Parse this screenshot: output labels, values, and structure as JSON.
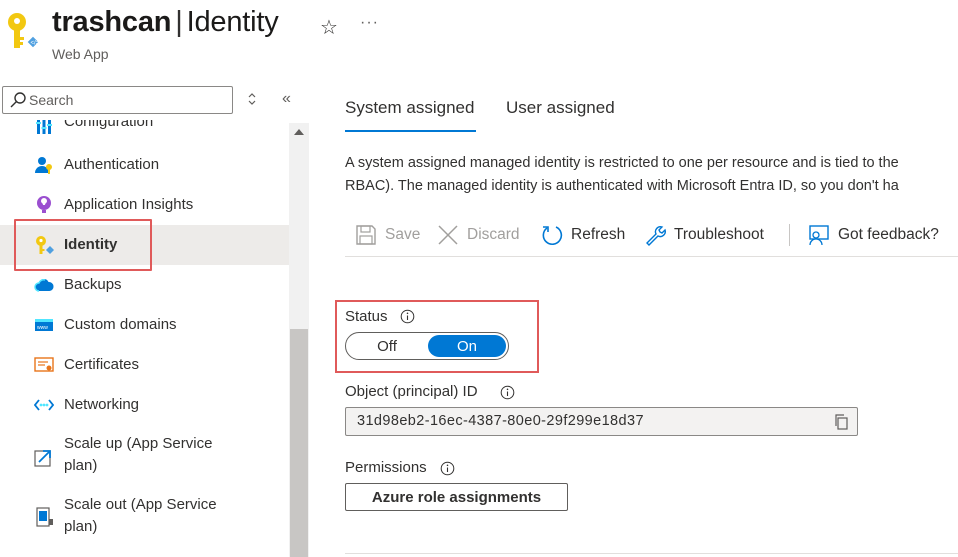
{
  "header": {
    "resource_name": "trashcan",
    "separator": "|",
    "page_name": "Identity",
    "subtitle": "Web App",
    "favorite_icon": "star-icon",
    "more_icon": "ellipsis-icon"
  },
  "sidebar": {
    "search_placeholder": "Search",
    "items": [
      {
        "label": "Configuration",
        "icon": "configuration-icon"
      },
      {
        "label": "Authentication",
        "icon": "authentication-icon"
      },
      {
        "label": "Application Insights",
        "icon": "application-insights-icon"
      },
      {
        "label": "Identity",
        "icon": "identity-key-icon",
        "active": true
      },
      {
        "label": "Backups",
        "icon": "backups-cloud-icon"
      },
      {
        "label": "Custom domains",
        "icon": "custom-domains-icon"
      },
      {
        "label": "Certificates",
        "icon": "certificates-icon"
      },
      {
        "label": "Networking",
        "icon": "networking-icon"
      },
      {
        "label": "Scale up (App Service",
        "label2": "plan)",
        "icon": "scale-up-icon"
      },
      {
        "label": "Scale out (App Service",
        "label2": "plan)",
        "icon": "scale-out-icon"
      }
    ]
  },
  "tabs": [
    {
      "label": "System assigned",
      "selected": true
    },
    {
      "label": "User assigned",
      "selected": false
    }
  ],
  "description": {
    "line1": "A system assigned managed identity is restricted to one per resource and is tied to the",
    "line2": "RBAC). The managed identity is authenticated with Microsoft Entra ID, so you don't ha"
  },
  "toolbar": {
    "save": "Save",
    "discard": "Discard",
    "refresh": "Refresh",
    "troubleshoot": "Troubleshoot",
    "feedback": "Got feedback?"
  },
  "status": {
    "label": "Status",
    "off_label": "Off",
    "on_label": "On",
    "value": "On"
  },
  "object_id": {
    "label": "Object (principal) ID",
    "value": "31d98eb2-16ec-4387-80e0-29f299e18d37"
  },
  "permissions": {
    "label": "Permissions",
    "button": "Azure role assignments"
  },
  "colors": {
    "accent": "#0078d4",
    "highlight_border": "#e05a5a",
    "identity_key": "#f2c811"
  }
}
